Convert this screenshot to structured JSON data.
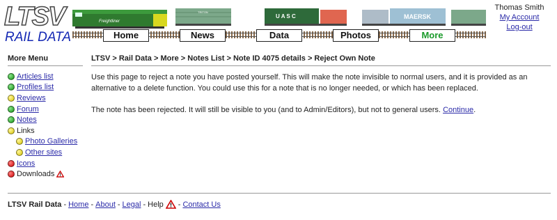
{
  "header": {
    "logo_top": "LTSV",
    "logo_bottom": "RAIL DATA",
    "nav": [
      "Home",
      "News",
      "Data",
      "Photos",
      "More"
    ],
    "active_nav": "More",
    "train_markings": {
      "loco": "Freightliner",
      "container1": "TRITON",
      "container2": "U A S C",
      "container3": "MAERSK"
    }
  },
  "user": {
    "name": "Thomas Smith",
    "account_link": "My Account",
    "logout_link": "Log-out"
  },
  "sidebar": {
    "title": "More Menu",
    "items": [
      {
        "label": "Articles list",
        "color": "green",
        "link": true,
        "indent": 0
      },
      {
        "label": "Profiles list",
        "color": "green",
        "link": true,
        "indent": 0
      },
      {
        "label": "Reviews",
        "color": "yellow",
        "link": true,
        "indent": 0
      },
      {
        "label": "Forum",
        "color": "green",
        "link": true,
        "indent": 0
      },
      {
        "label": "Notes",
        "color": "green",
        "link": true,
        "indent": 0
      },
      {
        "label": "Links",
        "color": "yellow",
        "link": false,
        "indent": 0
      },
      {
        "label": "Photo Galleries",
        "color": "yellow",
        "link": true,
        "indent": 1
      },
      {
        "label": "Other sites",
        "color": "yellow",
        "link": true,
        "indent": 1
      },
      {
        "label": "Icons",
        "color": "red",
        "link": true,
        "indent": 0
      },
      {
        "label": "Downloads",
        "color": "red",
        "link": false,
        "indent": 0,
        "warning_icon": true
      }
    ]
  },
  "breadcrumb": "LTSV > Rail Data > More > Notes List > Note ID 4075 details > Reject Own Note",
  "main": {
    "para1": "Use this page to reject a note you have posted yourself. This will make the note invisible to normal users, and it is provided as an alternative to a delete function. You could use this for a note that is no longer needed, or which has been replaced.",
    "para2": "The note has been rejected. It will still be visible to you (and to Admin/Editors), but not to general users.",
    "continue_link": "Continue",
    "period": "."
  },
  "footer": {
    "brand": "LTSV Rail Data",
    "dash": "-",
    "links": [
      "Home",
      "About",
      "Legal"
    ],
    "help": "Help",
    "contact": "Contact Us"
  },
  "colors": {
    "link": "#2a2aa8",
    "logo_blue": "#1428b4",
    "active_nav": "#1a9a2a",
    "dot_green": "#109010",
    "dot_yellow": "#d6c400",
    "dot_red": "#cc0000"
  }
}
